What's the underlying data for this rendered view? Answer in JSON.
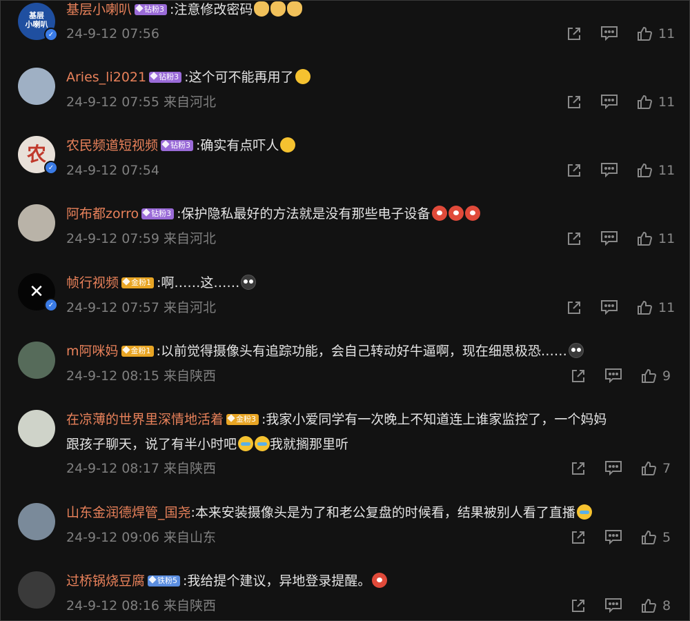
{
  "comments": [
    {
      "username": "基层小喇叭",
      "fan_label": "钻粉3",
      "fan_type": "diamond",
      "text": ":注意修改密码",
      "emojis": [
        "cat",
        "cat",
        "cat"
      ],
      "date": "24-9-12 07:56",
      "location": "",
      "likes": "11",
      "verified": true
    },
    {
      "username": "Aries_li2021",
      "fan_label": "钻粉3",
      "fan_type": "diamond",
      "text": ":这个可不能再用了",
      "emojis": [
        "sweat"
      ],
      "date": "24-9-12 07:55",
      "location": "来自河北",
      "likes": "11",
      "verified": false
    },
    {
      "username": "农民频道短视频",
      "fan_label": "钻粉3",
      "fan_type": "diamond",
      "text": ":确实有点吓人",
      "emojis": [
        "sweat"
      ],
      "date": "24-9-12 07:54",
      "location": "",
      "likes": "11",
      "verified": true
    },
    {
      "username": "阿布都zorro",
      "fan_label": "钻粉3",
      "fan_type": "diamond",
      "text": ":保护隐私最好的方法就是没有那些电子设备",
      "emojis": [
        "weibo",
        "weibo",
        "weibo"
      ],
      "date": "24-9-12 07:59",
      "location": "来自河北",
      "likes": "11",
      "verified": false
    },
    {
      "username": "帧行视频",
      "fan_label": "金粉1",
      "fan_type": "gold",
      "text": ":啊……这……",
      "emojis": [
        "shock"
      ],
      "date": "24-9-12 07:57",
      "location": "来自河北",
      "likes": "11",
      "verified": true
    },
    {
      "username": "m阿咪妈",
      "fan_label": "金粉1",
      "fan_type": "gold",
      "text": ":以前觉得摄像头有追踪功能，会自己转动好牛逼啊，现在细思极恐……",
      "emojis": [
        "shock"
      ],
      "date": "24-9-12 08:15",
      "location": "来自陕西",
      "likes": "9",
      "verified": false
    },
    {
      "username": "在凉薄的世界里深情地活着",
      "fan_label": "金粉3",
      "fan_type": "gold",
      "text": ":我家小爱同学有一次晚上不知道连上谁家监控了，一个妈妈",
      "text2": "跟孩子聊天，说了有半小时吧",
      "text2_tail": "我就搁那里听",
      "emojis": [],
      "date": "24-9-12 08:17",
      "location": "来自陕西",
      "likes": "7",
      "verified": false
    },
    {
      "username": "山东金润德焊管_国尧",
      "fan_label": "",
      "fan_type": "",
      "text": ":本来安装摄像头是为了和老公复盘的时候看，结果被别人看了直播",
      "emojis": [
        "cry"
      ],
      "date": "24-9-12 09:06",
      "location": "来自山东",
      "likes": "5",
      "verified": false
    },
    {
      "username": "过桥锅烧豆腐",
      "fan_label": "铁粉5",
      "fan_type": "iron",
      "text": ":我给提个建议，异地登录提醒。",
      "emojis": [
        "weibo"
      ],
      "date": "24-9-12 08:16",
      "location": "来自陕西",
      "likes": "8",
      "verified": false
    }
  ],
  "avatars": [
    {
      "bg": "#1f4fa0",
      "label": "基层\n小喇叭"
    },
    {
      "bg": "#9fb0c4",
      "label": ""
    },
    {
      "bg": "#e8e0d8",
      "label": "农"
    },
    {
      "bg": "#b9b3a8",
      "label": ""
    },
    {
      "bg": "#050505",
      "label": "X"
    },
    {
      "bg": "#566b5a",
      "label": ""
    },
    {
      "bg": "#cfd3c9",
      "label": ""
    },
    {
      "bg": "#7a8a9a",
      "label": ""
    },
    {
      "bg": "#3a3a3a",
      "label": ""
    }
  ],
  "colors": {
    "username": "#e8815a",
    "text": "#e4e4e4",
    "meta": "#7f7f7f",
    "background": "#121212"
  }
}
